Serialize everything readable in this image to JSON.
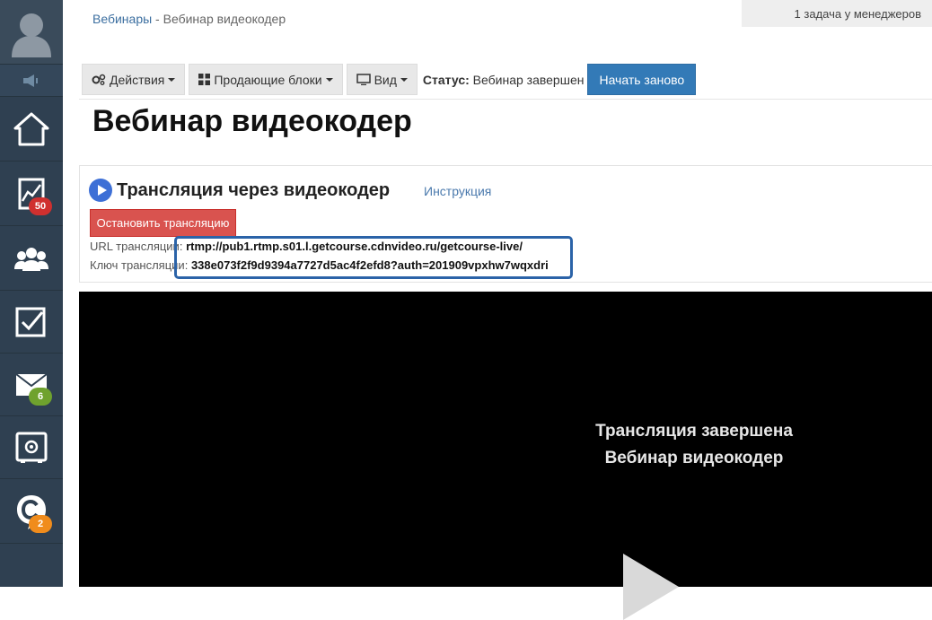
{
  "breadcrumb": {
    "parent": "Вебинары",
    "separator": " - ",
    "current": "Вебинар видеокодер"
  },
  "tasks_info": "1 задача у менеджеров",
  "toolbar": {
    "actions_label": "Действия",
    "blocks_label": "Продающие блоки",
    "view_label": "Вид",
    "status_label": "Статус:",
    "status_value": "Вебинар завершен",
    "restart_label": "Начать заново"
  },
  "page_title": "Вебинар видеокодер",
  "stream": {
    "title": "Трансляция через видеокодер",
    "instruction_link": "Инструкция",
    "stop_button": "Остановить трансляцию",
    "url_label": "URL трансляции:",
    "url_value": "rtmp://pub1.rtmp.s01.l.getcourse.cdnvideo.ru/getcourse-live/",
    "key_label": "Ключ трансляции:",
    "key_value": "338e073f2f9d9394a7727d5ac4f2efd8?auth=201909vpxhw7wqxdri"
  },
  "video": {
    "line1": "Трансляция завершена",
    "line2": "Вебинар видеокодер"
  },
  "sidebar": {
    "stats_badge": "50",
    "mail_badge": "6",
    "chat_badge": "2"
  },
  "colors": {
    "sidebar_bg": "#2f4051",
    "primary": "#337ab7",
    "danger": "#d9534f",
    "highlight_border": "#2b63a8"
  }
}
